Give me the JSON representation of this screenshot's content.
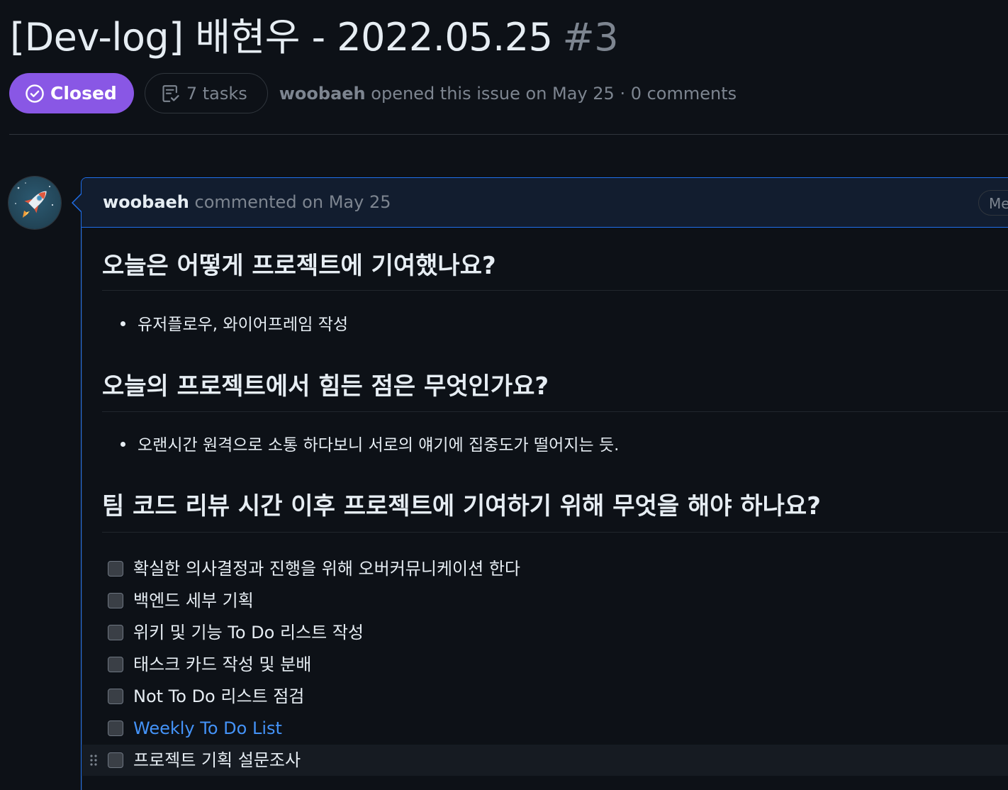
{
  "issue": {
    "title": "[Dev-log] 배현우 - 2022.05.25",
    "number": "#3",
    "state_label": "Closed",
    "tasks_label": "7 tasks",
    "author": "woobaeh",
    "opened_text": "opened this issue on May 25 · 0 comments"
  },
  "comment": {
    "author": "woobaeh",
    "action_text": "commented on May 25",
    "badge_text": "Me"
  },
  "body": {
    "sections": [
      {
        "heading": "오늘은 어떻게 프로젝트에 기여했나요?",
        "bullets": [
          "유저플로우, 와이어프레임 작성"
        ]
      },
      {
        "heading": "오늘의 프로젝트에서 힘든 점은 무엇인가요?",
        "bullets": [
          "오랜시간 원격으로 소통 하다보니 서로의 얘기에 집중도가 떨어지는 듯."
        ]
      },
      {
        "heading": "팀 코드 리뷰 시간 이후 프로젝트에 기여하기 위해 무엇을 해야 하나요?"
      }
    ],
    "tasks": [
      {
        "label": "확실한 의사결정과 진행을 위해 오버커뮤니케이션 한다",
        "checked": false
      },
      {
        "label": "백엔드 세부 기획",
        "checked": false
      },
      {
        "label": "위키 및 기능 To Do 리스트 작성",
        "checked": false
      },
      {
        "label": "태스크 카드 작성 및 분배",
        "checked": false
      },
      {
        "label": "Not To Do 리스트 점검",
        "checked": false
      },
      {
        "label": "Weekly To Do List",
        "checked": false,
        "is_link": true
      },
      {
        "label": "프로젝트 기획 설문조사",
        "checked": false
      }
    ]
  },
  "colors": {
    "background": "#0d1117",
    "closed_badge": "#8957e5",
    "comment_border": "#1f6feb",
    "comment_header_bg": "#121d2f",
    "link": "#4493f8",
    "muted_text": "#7d8590"
  },
  "icons": {
    "state": "check-circle-icon",
    "tasks": "tasklist-icon",
    "avatar": "rocket-icon",
    "drag": "grabber-icon"
  }
}
